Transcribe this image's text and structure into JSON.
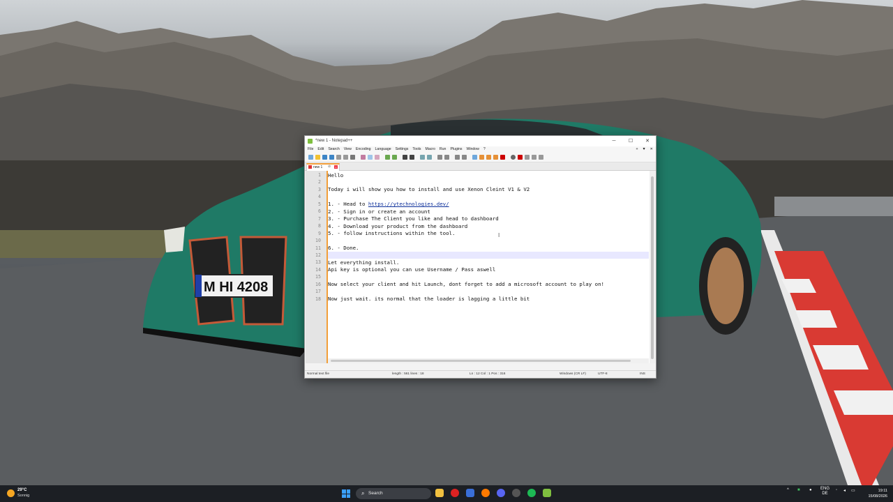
{
  "window": {
    "title": "*new 1 - Notepad++",
    "buttons": {
      "minimize": "─",
      "maximize": "☐",
      "close": "✕"
    }
  },
  "menu": [
    "File",
    "Edit",
    "Search",
    "View",
    "Encoding",
    "Language",
    "Settings",
    "Tools",
    "Macro",
    "Run",
    "Plugins",
    "Window",
    "?"
  ],
  "menu_right": [
    "+",
    "▼",
    "✕"
  ],
  "tab": {
    "name": "new 1",
    "pin": "⊘",
    "close": "x"
  },
  "editor": {
    "lines": [
      {
        "n": "1",
        "text": "Hello"
      },
      {
        "n": "2",
        "text": ""
      },
      {
        "n": "3",
        "text": "Today i will show you how to install and use Xenon Cleint V1 & V2"
      },
      {
        "n": "4",
        "text": ""
      },
      {
        "n": "5",
        "text": "1. - Head to ",
        "link": "https://ytechnologies.dev/"
      },
      {
        "n": "6",
        "text": "2. - Sign in or create an account"
      },
      {
        "n": "7",
        "text": "3. - Purchase The Client you like and head to dashboard"
      },
      {
        "n": "8",
        "text": "4. - Download your product from the dashboard"
      },
      {
        "n": "9",
        "text": "5. - follow instructions within the tool."
      },
      {
        "n": "10",
        "text": ""
      },
      {
        "n": "11",
        "text": "6. - Done."
      },
      {
        "n": "12",
        "text": ""
      },
      {
        "n": "13",
        "text": "Let everything install."
      },
      {
        "n": "14",
        "text": "Api key is optional you can use Username / Pass aswell"
      },
      {
        "n": "15",
        "text": ""
      },
      {
        "n": "16",
        "text": "Now select your client and hit Launch, dont forget to add a microsoft account to play on!"
      },
      {
        "n": "17",
        "text": ""
      },
      {
        "n": "18",
        "text": "Now just wait. its normal that the loader is lagging a little bit"
      }
    ]
  },
  "status": {
    "type": "Normal text file",
    "length": "length : 561    lines : 18",
    "position": "Ln : 12    Col : 1    Pos : 316",
    "eol": "Windows (CR LF)",
    "encoding": "UTF-8",
    "mode": "INS"
  },
  "taskbar": {
    "weather_temp": "29°C",
    "weather_cond": "Sonnig",
    "search_label": "Search",
    "lang_top": "ENG",
    "lang_bottom": "DE",
    "time": "19:11",
    "date": "15/08/2026"
  },
  "colors": {
    "accent": "#f29e38",
    "link": "#0c2f9a",
    "taskbar": "#1c1f24"
  }
}
